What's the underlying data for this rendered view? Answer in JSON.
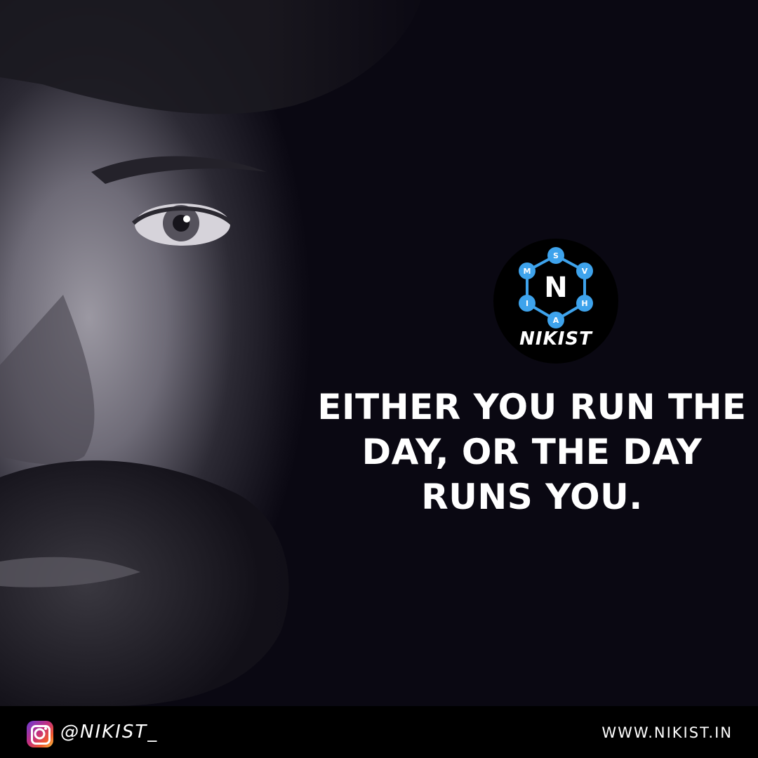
{
  "brand": {
    "logo_letter": "N",
    "logo_word": "NIKIST",
    "logo_nodes": [
      "S",
      "V",
      "H",
      "A",
      "I",
      "M"
    ],
    "node_color": "#3ea3ec"
  },
  "quote": {
    "line1": "EITHER YOU RUN THE",
    "line2": "DAY, OR THE DAY",
    "line3": "RUNS YOU."
  },
  "footer": {
    "instagram_icon": "instagram-icon",
    "handle": "@NIKIST_",
    "website": "WWW.NIKIST.IN"
  },
  "colors": {
    "background": "#0a0812",
    "footer": "#000000",
    "text": "#ffffff"
  }
}
